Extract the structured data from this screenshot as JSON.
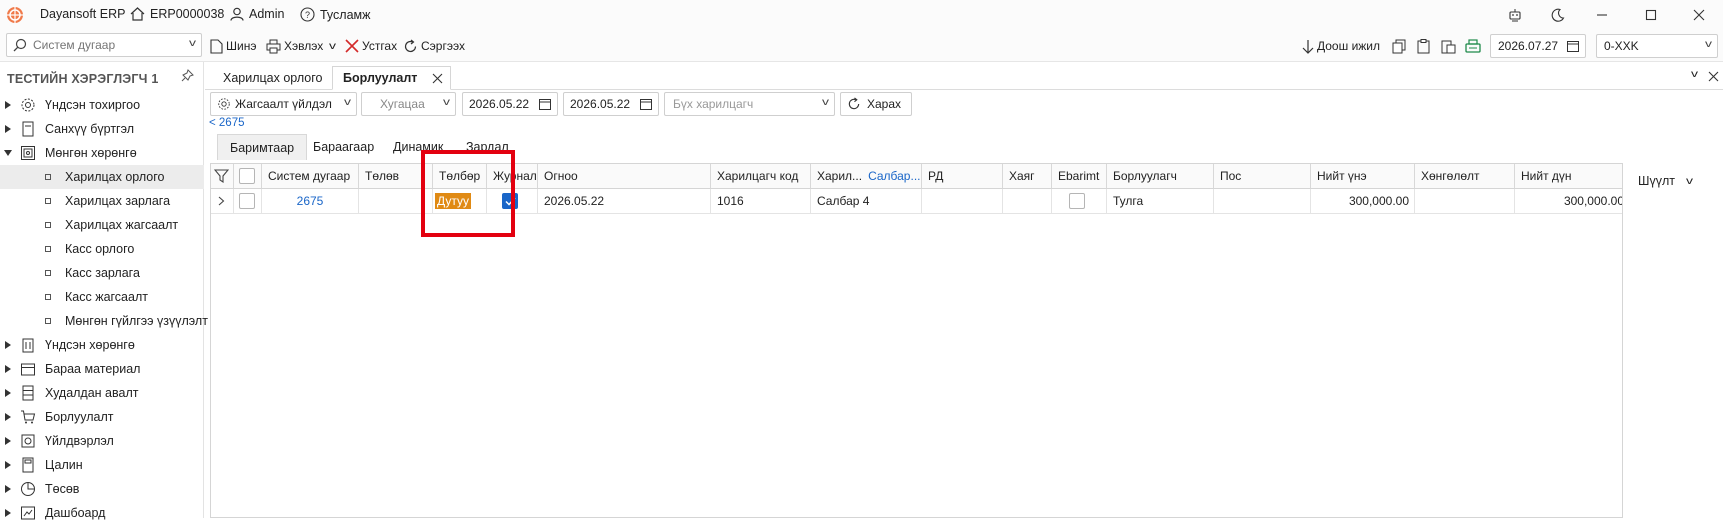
{
  "titlebar": {
    "app_name": "Dayansoft ERP",
    "company_code": "ERP0000038",
    "user": "Admin",
    "help": "Тусламж",
    "brand_color": "#e8542a"
  },
  "toolbar": {
    "search_placeholder": "Систем дугаар",
    "new_label": "Шинэ",
    "print_label": "Хэвлэх",
    "delete_label": "Устгах",
    "refresh_label": "Сэргээх",
    "sort_label": "Доош ижил",
    "date": "2026.07.27",
    "period": "0-XXK"
  },
  "sidebar": {
    "title": "ТЕСТИЙН ХЭРЭГЛЭГЧ 1",
    "items": [
      {
        "label": "Үндсэн тохиргоо",
        "icon": "gear-icon",
        "state": "collapsed"
      },
      {
        "label": "Санхүү бүртгэл",
        "icon": "ledger-icon",
        "state": "collapsed"
      },
      {
        "label": "Мөнгөн хөрөнгө",
        "icon": "safe-icon",
        "state": "expanded"
      },
      {
        "label": "Үндсэн хөрөнгө",
        "icon": "building-icon",
        "state": "collapsed"
      },
      {
        "label": "Бараа материал",
        "icon": "box-icon",
        "state": "collapsed"
      },
      {
        "label": "Худалдан авалт",
        "icon": "cabinet-icon",
        "state": "collapsed"
      },
      {
        "label": "Борлуулалт",
        "icon": "cart-icon",
        "state": "collapsed"
      },
      {
        "label": "Үйлдвэрлэл",
        "icon": "factory-icon",
        "state": "collapsed"
      },
      {
        "label": "Цалин",
        "icon": "calculator-icon",
        "state": "collapsed"
      },
      {
        "label": "Төсөв",
        "icon": "pie-icon",
        "state": "collapsed"
      },
      {
        "label": "Дашбоард",
        "icon": "dashboard-icon",
        "state": "collapsed"
      }
    ],
    "subitems": [
      {
        "label": "Харилцах орлого",
        "selected": true
      },
      {
        "label": "Харилцах зарлага",
        "selected": false
      },
      {
        "label": "Харилцах жагсаалт",
        "selected": false
      },
      {
        "label": "Касс орлого",
        "selected": false
      },
      {
        "label": "Касс зарлага",
        "selected": false
      },
      {
        "label": "Касс жагсаалт",
        "selected": false
      },
      {
        "label": "Мөнгөн гүйлгээ үзүүлэлт",
        "selected": false
      }
    ]
  },
  "doc_tabs": [
    {
      "label": "Харилцах орлого",
      "active": false
    },
    {
      "label": "Борлуулалт",
      "active": true
    }
  ],
  "filters": {
    "settings_label": "Жагсаалт үйлдэл",
    "period_placeholder": "Хугацаа",
    "date_from": "2026.05.22",
    "date_to": "2026.05.22",
    "customer_placeholder": "Бүх харилцагч",
    "view_label": "Харах",
    "back_link": "< 2675"
  },
  "inner_tabs": [
    {
      "label": "Баримтаар",
      "active": true
    },
    {
      "label": "Бараагаар",
      "active": false
    },
    {
      "label": "Динамик",
      "active": false
    },
    {
      "label": "Зардал",
      "active": false
    }
  ],
  "table": {
    "columns": [
      "Систем дугаар",
      "Төлөв",
      "Төлбөр",
      "Журнал",
      "Огноо",
      "Харилцагч код",
      "Харил...",
      "Салбар...",
      "РД",
      "Хаяг",
      "Ebarimt",
      "Борлуулагч",
      "Пос",
      "Нийт үнэ",
      "Хөнгөлөлт",
      "Нийт дүн"
    ],
    "rows": [
      {
        "system_no": "2675",
        "status": "",
        "payment": "Дутуу",
        "journal": true,
        "date": "2026.05.22",
        "customer_code": "1016",
        "customer": "Салбар 4",
        "branch": "",
        "rd": "",
        "address": "",
        "ebarimt": false,
        "seller": "Тулга",
        "pos": "",
        "total_price": "300,000.00",
        "discount": "",
        "net_total": "300,000.00"
      }
    ],
    "payment_badge_color": "#e08a14",
    "link_color": "#1a66c8"
  },
  "right_panel": {
    "filter_label": "Шүүлт"
  }
}
